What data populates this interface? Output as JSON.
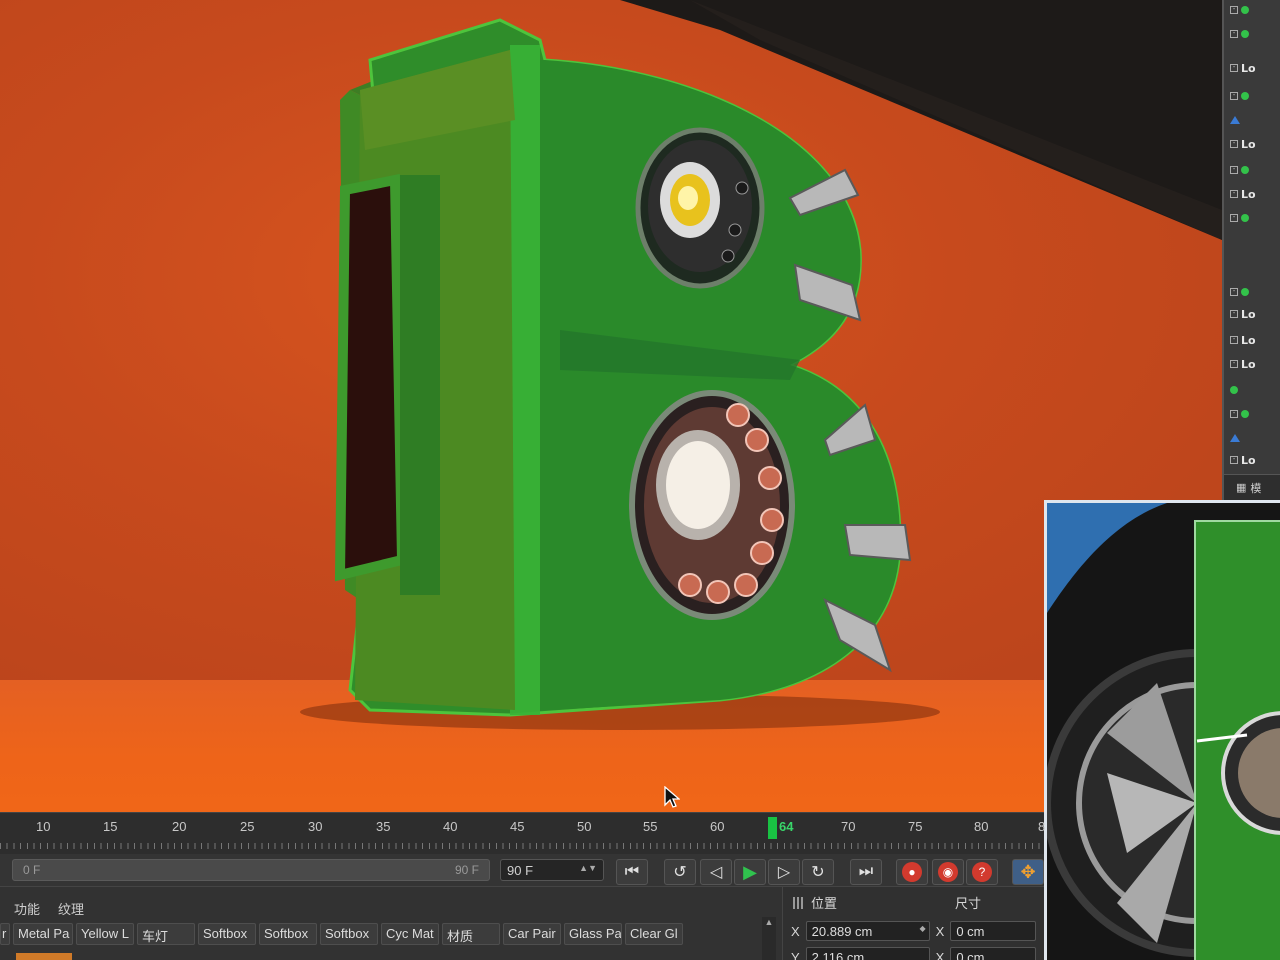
{
  "timeline": {
    "ticks": [
      "10",
      "15",
      "20",
      "25",
      "30",
      "35",
      "40",
      "45",
      "50",
      "55",
      "60",
      "70",
      "75",
      "80",
      "8"
    ],
    "current_frame": "64"
  },
  "transport": {
    "range_start": "0 F",
    "range_end": "90 F",
    "end_frame": "90 F",
    "buttons": {
      "goto_start": "⏮",
      "prev_key": "↺",
      "prev_frame": "◁",
      "play": "▶",
      "next_frame": "▷",
      "next_key": "↻",
      "goto_end": "⏭",
      "help": "?"
    }
  },
  "material_panel": {
    "menu": [
      "功能",
      "纹理"
    ],
    "materials": [
      "Metal Pa",
      "Yellow L",
      "车灯",
      "Softbox",
      "Softbox",
      "Softbox",
      "Cyc Mat",
      "材质",
      "Car Pair",
      "Glass Pa",
      "Clear Gl"
    ]
  },
  "attributes": {
    "position_label": "位置",
    "size_label": "尺寸",
    "x_label": "X",
    "x_position": "20.889 cm",
    "x_size": "0 cm",
    "y_label": "Y",
    "y_position": "2.116 cm",
    "y_size": "0 cm"
  },
  "object_manager": {
    "footer_label": "模"
  },
  "colors": {
    "background_orange": "#d2511f",
    "object_green": "#2f9a2c",
    "playhead_green": "#19c243",
    "record_red": "#d23a2e"
  }
}
